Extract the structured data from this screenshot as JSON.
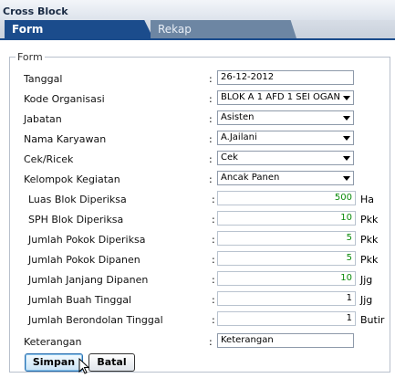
{
  "window": {
    "title": "Cross Block"
  },
  "tabs": [
    {
      "label": "Form",
      "active": true
    },
    {
      "label": "Rekap",
      "active": false
    }
  ],
  "form": {
    "legend": "Form",
    "fields": [
      {
        "label": "Tanggal",
        "value": "26-12-2012",
        "type": "text"
      },
      {
        "label": "Kode Organisasi",
        "value": "BLOK A 1 AFD 1 SEI OGAN",
        "type": "select"
      },
      {
        "label": "Jabatan",
        "value": "Asisten",
        "type": "select"
      },
      {
        "label": "Nama Karyawan",
        "value": "A.Jailani",
        "type": "select"
      },
      {
        "label": "Cek/Ricek",
        "value": "Cek",
        "type": "select"
      },
      {
        "label": "Kelompok Kegiatan",
        "value": "Ancak Panen",
        "type": "select"
      },
      {
        "label": "Luas Blok Diperiksa",
        "value": "500",
        "unit": "Ha",
        "type": "number"
      },
      {
        "label": "SPH Blok Diperiksa",
        "value": "10",
        "unit": "Pkk",
        "type": "number"
      },
      {
        "label": "Jumlah Pokok Diperiksa",
        "value": "5",
        "unit": "Pkk",
        "type": "number"
      },
      {
        "label": "Jumlah Pokok Dipanen",
        "value": "5",
        "unit": "Pkk",
        "type": "number"
      },
      {
        "label": "Jumlah Janjang Dipanen",
        "value": "10",
        "unit": "Jjg",
        "type": "number"
      },
      {
        "label": "Jumlah Buah Tinggal",
        "value": "1",
        "unit": "Jjg",
        "type": "number"
      },
      {
        "label": "Jumlah Berondolan Tinggal",
        "value": "1",
        "unit": "Butir",
        "type": "number"
      },
      {
        "label": "Keterangan",
        "value": "Keterangan",
        "type": "text"
      }
    ],
    "colon": ":"
  },
  "buttons": {
    "save": "Simpan",
    "cancel": "Batal"
  },
  "colors": {
    "tab_active": "#1b4c8c",
    "tab_inactive": "#6d86a3",
    "number_text": "#0a8a0a"
  }
}
